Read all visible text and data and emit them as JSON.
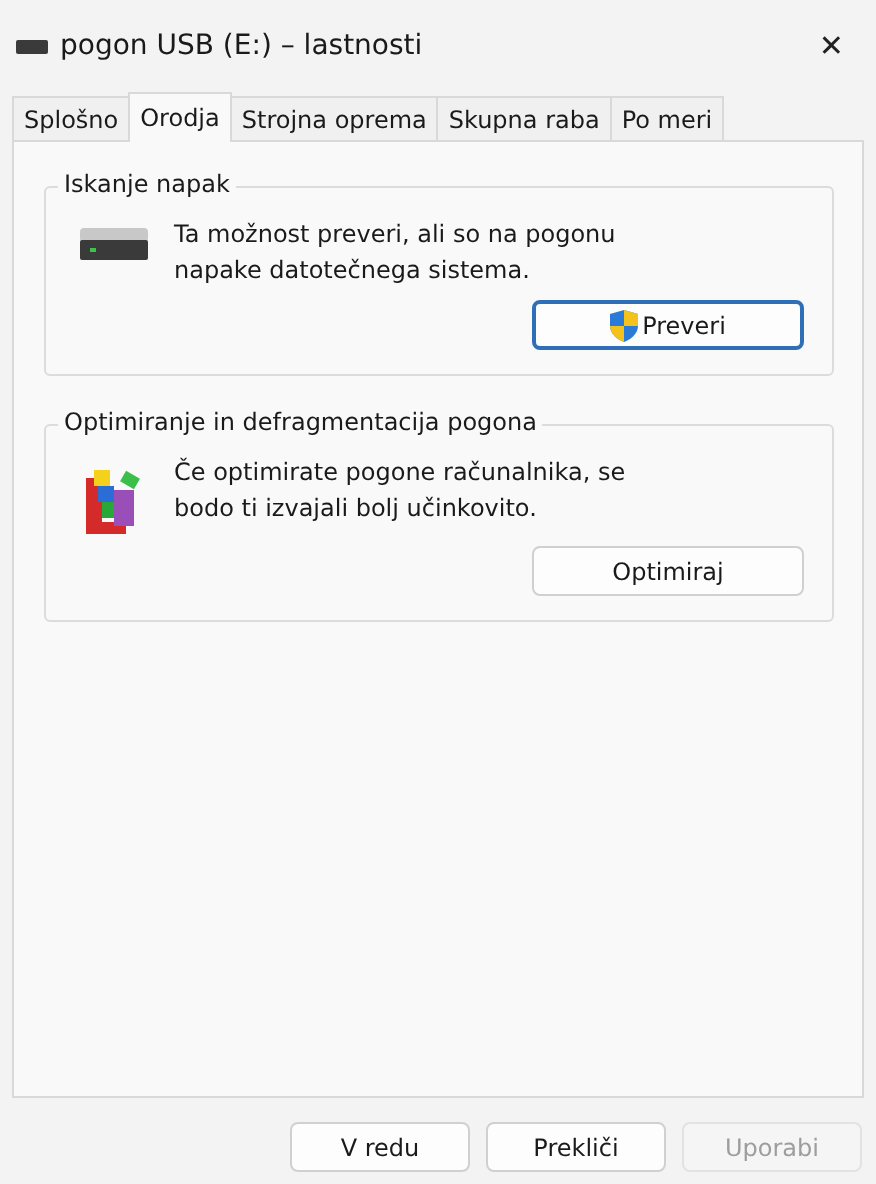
{
  "window": {
    "title": "pogon USB (E:) – lastnosti",
    "close": "✕"
  },
  "tabs": [
    {
      "label": "Splošno",
      "selected": false
    },
    {
      "label": "Orodja",
      "selected": true
    },
    {
      "label": "Strojna oprema",
      "selected": false
    },
    {
      "label": "Skupna raba",
      "selected": false
    },
    {
      "label": "Po meri",
      "selected": false
    }
  ],
  "groups": [
    {
      "title": "Iskanje napak",
      "kind": "drive",
      "text": "Ta možnost preveri, ali so na pogonu napake datotečnega sistema.",
      "button": {
        "label": "Preveri",
        "shield": true,
        "focused": true
      }
    },
    {
      "title": "Optimiranje in defragmentacija pogona",
      "kind": "defrag",
      "text": "Če optimirate pogone računalnika, se bodo ti izvajali bolj učinkovito.",
      "button": {
        "label": "Optimiraj",
        "shield": false,
        "focused": false
      }
    }
  ],
  "buttons": [
    {
      "label": "V redu",
      "disabled": false
    },
    {
      "label": "Prekliči",
      "disabled": false
    },
    {
      "label": "Uporabi",
      "disabled": true
    }
  ]
}
